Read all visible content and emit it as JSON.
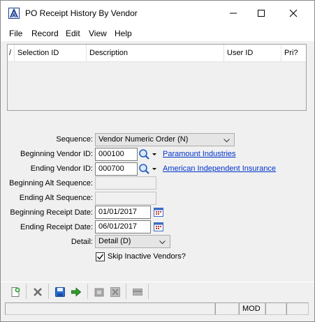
{
  "window": {
    "title": "PO Receipt History By Vendor"
  },
  "menu": [
    "File",
    "Record",
    "Edit",
    "View",
    "Help"
  ],
  "grid": {
    "columns": [
      "/",
      "Selection ID",
      "Description",
      "User ID",
      "Pri?"
    ],
    "rows": []
  },
  "form": {
    "sequence_label": "Sequence:",
    "sequence_value": "Vendor Numeric Order (N)",
    "begin_vendor_label": "Beginning Vendor ID:",
    "begin_vendor_value": "000100",
    "begin_vendor_name": "Paramount Industries",
    "end_vendor_label": "Ending Vendor ID:",
    "end_vendor_value": "000700",
    "end_vendor_name": "American Independent Insurance",
    "begin_alt_label": "Beginning Alt Sequence:",
    "begin_alt_value": "",
    "end_alt_label": "Ending Alt Sequence:",
    "end_alt_value": "",
    "begin_receipt_label": "Beginning Receipt Date:",
    "begin_receipt_value": "01/01/2017",
    "end_receipt_label": "Ending Receipt Date:",
    "end_receipt_value": "06/01/2017",
    "detail_label": "Detail:",
    "detail_value": "Detail (D)",
    "skip_inactive_label": "Skip Inactive Vendors?",
    "skip_inactive_checked": true
  },
  "toolbar": {
    "icons": [
      "new-record-icon",
      "delete-icon",
      "save-icon",
      "proceed-arrow-icon",
      "print-icon",
      "delete-selection-icon",
      "panel-icon"
    ]
  },
  "status": {
    "mode": "MOD"
  },
  "colors": {
    "link": "#0033cc",
    "accent": "#1a3d8f"
  }
}
